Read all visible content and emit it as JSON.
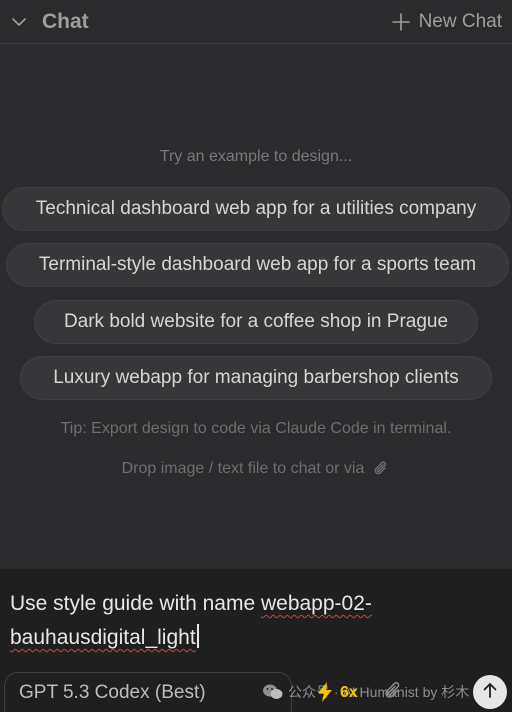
{
  "header": {
    "title": "Chat",
    "new_chat_label": "New Chat",
    "collapse_icon": "chevron-down-icon",
    "new_icon": "plus-icon"
  },
  "examples": {
    "hint": "Try an example to design...",
    "items": [
      "Technical dashboard web app for a utilities company",
      "Terminal-style dashboard web app for a sports team",
      "Dark bold website for a coffee shop in Prague",
      "Luxury webapp for managing barbershop clients"
    ],
    "tip": "Tip: Export design to code via Claude Code in terminal.",
    "drop": "Drop image / text file to chat or via"
  },
  "composer": {
    "text_plain": "Use style guide with name ",
    "text_squiggle_1": "webapp-02-",
    "text_squiggle_2": "bauhausdigital_light",
    "model": "GPT 5.3 Codex (Best)",
    "speed": "6x",
    "watermark": "公众号 · AI Humanist by 杉木"
  },
  "colors": {
    "background": "#2b2b2d",
    "composer_bg": "#1f1f20",
    "pill_bg": "#373739",
    "accent_bolt": "#f5c400",
    "spell_error": "#d0443a"
  }
}
